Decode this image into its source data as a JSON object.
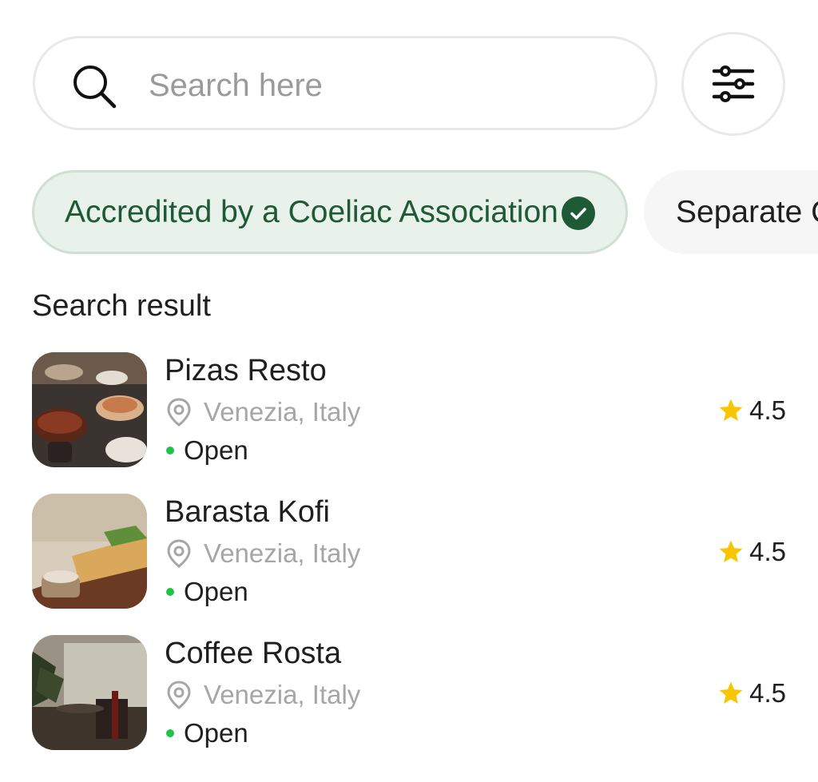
{
  "search": {
    "placeholder": "Search here",
    "value": ""
  },
  "filters": [
    {
      "label": "Accredited by a Coeliac Association",
      "selected": true
    },
    {
      "label": "Separate C",
      "selected": false
    }
  ],
  "section_title": "Search result",
  "results": [
    {
      "name": "Pizas Resto",
      "location": "Venezia, Italy",
      "status": "Open",
      "rating": "4.5"
    },
    {
      "name": "Barasta Kofi",
      "location": "Venezia, Italy",
      "status": "Open",
      "rating": "4.5"
    },
    {
      "name": "Coffee Rosta",
      "location": "Venezia, Italy",
      "status": "Open",
      "rating": "4.5"
    }
  ],
  "icons": {
    "search": "search-icon",
    "filter": "sliders-icon",
    "check": "check-circle-icon",
    "location": "map-pin-icon",
    "rating": "star-icon"
  },
  "colors": {
    "accent_green": "#1e5a35",
    "chip_active_bg": "#e8f1ea",
    "open_status": "#1fc24a",
    "star": "#f7c600",
    "muted_text": "#a6a6a6"
  }
}
